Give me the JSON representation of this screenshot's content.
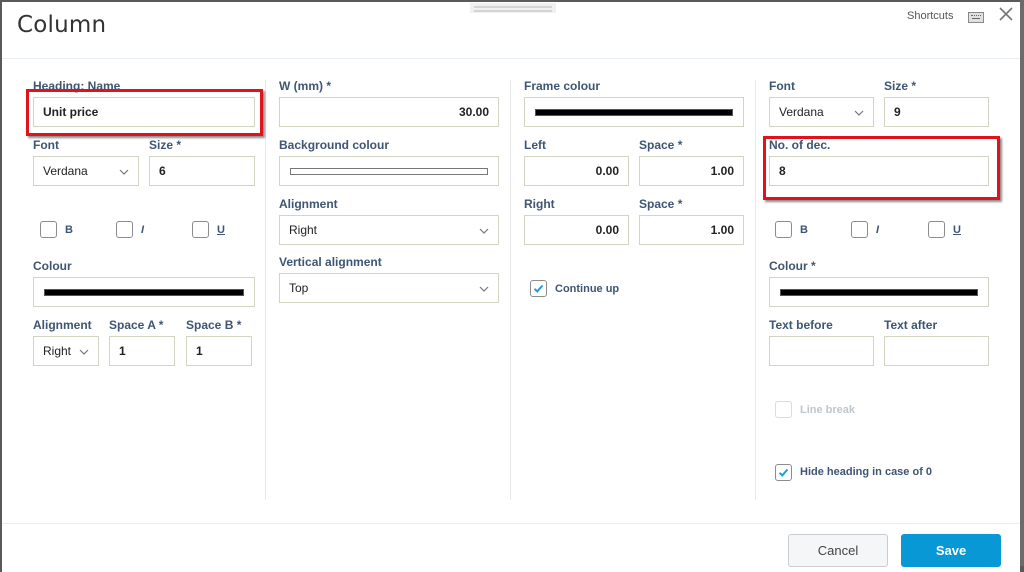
{
  "dialog": {
    "title": "Column",
    "shortcuts_label": "Shortcuts",
    "icons": {
      "keyboard": "keyboard-icon",
      "close": "close-icon",
      "chevron": "chevron-down-icon",
      "check": "checkmark-icon"
    }
  },
  "col1": {
    "heading_name_label": "Heading: Name",
    "heading_name_value": "Unit price",
    "font_label": "Font",
    "font_value": "Verdana",
    "size_label": "Size *",
    "size_value": "6",
    "bold_label": "B",
    "italic_label": "I",
    "underline_label": "U",
    "bold_checked": false,
    "italic_checked": false,
    "underline_checked": false,
    "colour_label": "Colour",
    "colour_value": "#000000",
    "alignment_label": "Alignment",
    "alignment_value": "Right",
    "space_a_label": "Space A *",
    "space_a_value": "1",
    "space_b_label": "Space B *",
    "space_b_value": "1"
  },
  "col2": {
    "width_label": "W (mm) *",
    "width_value": "30.00",
    "bg_colour_label": "Background colour",
    "bg_colour_value": "#ffffff",
    "alignment_label": "Alignment",
    "alignment_value": "Right",
    "valign_label": "Vertical alignment",
    "valign_value": "Top"
  },
  "col3": {
    "frame_colour_label": "Frame colour",
    "frame_colour_value": "#000000",
    "left_label": "Left",
    "left_value": "0.00",
    "left_space_label": "Space *",
    "left_space_value": "1.00",
    "right_label": "Right",
    "right_value": "0.00",
    "right_space_label": "Space *",
    "right_space_value": "1.00",
    "continue_up_label": "Continue up",
    "continue_up_checked": true
  },
  "col4": {
    "font_label": "Font",
    "font_value": "Verdana",
    "size_label": "Size *",
    "size_value": "9",
    "decimals_label": "No. of dec.",
    "decimals_value": "8",
    "bold_label": "B",
    "italic_label": "I",
    "underline_label": "U",
    "bold_checked": false,
    "italic_checked": false,
    "underline_checked": false,
    "colour_label": "Colour *",
    "colour_value": "#000000",
    "text_before_label": "Text before",
    "text_before_value": "",
    "text_after_label": "Text after",
    "text_after_value": "",
    "line_break_label": "Line break",
    "line_break_checked": false,
    "line_break_disabled": true,
    "hide_heading_label": "Hide heading in case of 0",
    "hide_heading_checked": true
  },
  "footer": {
    "cancel_label": "Cancel",
    "save_label": "Save"
  },
  "colors": {
    "accent": "#0898d6",
    "highlight": "#e0121c",
    "label": "#3e5573"
  }
}
